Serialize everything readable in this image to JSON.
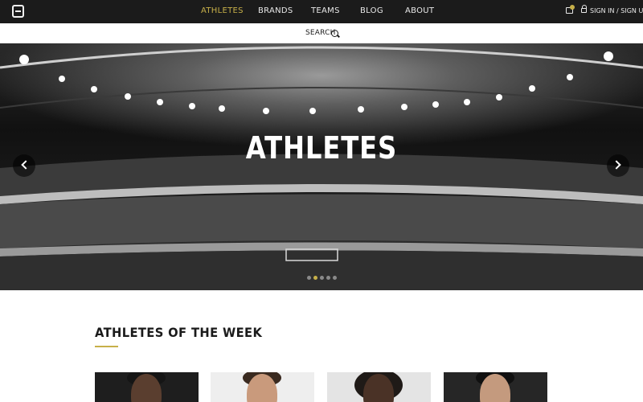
{
  "nav": {
    "items": [
      {
        "label": "ATHLETES",
        "active": true
      },
      {
        "label": "BRANDS",
        "active": false
      },
      {
        "label": "TEAMS",
        "active": false
      },
      {
        "label": "BLOG",
        "active": false
      },
      {
        "label": "ABOUT",
        "active": false
      }
    ],
    "signin_label": "SIGN IN / SIGN UP"
  },
  "search": {
    "label": "SEARCH"
  },
  "hero": {
    "title": "ATHLETES",
    "slide_count": 5,
    "active_slide": 2
  },
  "section": {
    "title": "ATHLETES OF THE WEEK"
  },
  "colors": {
    "accent": "#c7b049",
    "dark": "#1b1b1b"
  },
  "icons": [
    "logo-icon",
    "cart-icon",
    "lock-icon",
    "search-icon",
    "chevron-left-icon",
    "chevron-right-icon"
  ]
}
